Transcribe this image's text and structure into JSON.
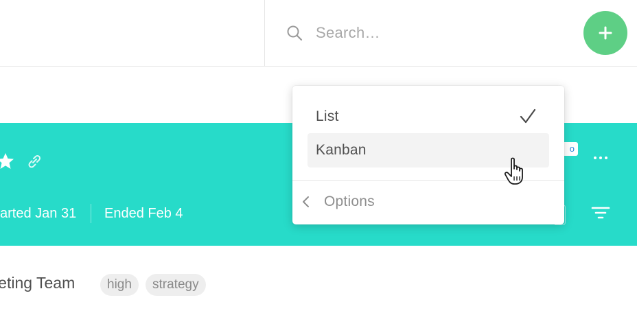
{
  "header": {
    "search": {
      "placeholder": "Search…",
      "value": ""
    },
    "add_button": {
      "icon": "plus-icon",
      "color": "#5ecf85"
    }
  },
  "project_banner": {
    "color": "#27dbc9",
    "icons": [
      "star-icon",
      "link-icon",
      "more-icon",
      "filter-icon"
    ],
    "date_started": "arted Jan 31",
    "date_ended": "Ended Feb 4",
    "badge_fragment": "o"
  },
  "team_row": {
    "name": "rketing Team",
    "tags": [
      "high",
      "strategy"
    ]
  },
  "view_menu": {
    "items": [
      {
        "label": "List",
        "selected": true
      },
      {
        "label": "Kanban",
        "selected": false,
        "hovered": true
      }
    ],
    "options_label": "Options"
  }
}
